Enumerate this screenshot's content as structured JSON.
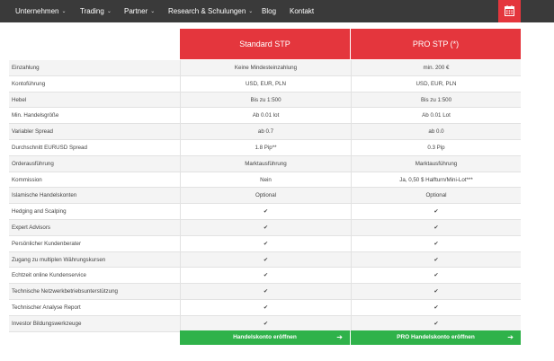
{
  "nav": {
    "items": [
      {
        "label": "Unternehmen",
        "dropdown": true
      },
      {
        "label": "Trading",
        "dropdown": true
      },
      {
        "label": "Partner",
        "dropdown": true
      },
      {
        "label": "Research & Schulungen",
        "dropdown": true
      },
      {
        "label": "Blog",
        "dropdown": false
      },
      {
        "label": "Kontakt",
        "dropdown": false
      }
    ],
    "chevron": "⌄",
    "calendar_icon": "calendar-icon"
  },
  "plans": {
    "standard": "Standard STP",
    "pro": "PRO STP (*)"
  },
  "check_mark": "✔",
  "rows": [
    {
      "label": "Einzahlung",
      "standard": "Keine Mindesteinzahlung",
      "pro": "min. 200 €"
    },
    {
      "label": "Kontoführung",
      "standard": "USD, EUR, PLN",
      "pro": "USD, EUR, PLN"
    },
    {
      "label": "Hebel",
      "standard": "Bis zu 1:500",
      "pro": "Bis zu 1:500"
    },
    {
      "label": "Min. Handelsgröße",
      "standard": "Ab 0.01 lot",
      "pro": "Ab 0.01 Lot"
    },
    {
      "label": "Variabler Spread",
      "standard": "ab 0.7",
      "pro": "ab 0.0"
    },
    {
      "label": "Durchschnitt EURUSD Spread",
      "standard": "1.8 Pip**",
      "pro": "0.3 Pip"
    },
    {
      "label": "Orderausführung",
      "standard": "Marktausführung",
      "pro": "Marktausführung"
    },
    {
      "label": "Kommission",
      "standard": "Nein",
      "pro": "Ja, 0,50 $ Halfturn/Mini-Lot***"
    },
    {
      "label": "Islamische Handelskonten",
      "standard": "Optional",
      "pro": "Optional"
    },
    {
      "label": "Hedging and Scalping",
      "standard": "✔",
      "pro": "✔"
    },
    {
      "label": "Expert Advisors",
      "standard": "✔",
      "pro": "✔"
    },
    {
      "label": "Persönlicher Kundenberater",
      "standard": "✔",
      "pro": "✔"
    },
    {
      "label": "Zugang zu multiplen Währungskursen",
      "standard": "✔",
      "pro": "✔"
    },
    {
      "label": "Echtzeit online Kundenservice",
      "standard": "✔",
      "pro": "✔"
    },
    {
      "label": "Technische Netzwerkbetriebsunterstützung",
      "standard": "✔",
      "pro": "✔"
    },
    {
      "label": "Technischer Analyse Report",
      "standard": "✔",
      "pro": "✔"
    },
    {
      "label": "Investor Bildungswerkzeuge",
      "standard": "✔",
      "pro": "✔"
    }
  ],
  "cta": {
    "standard": "Handelskonto eröffnen",
    "pro": "PRO Handelskonto eröffnen",
    "arrow": "➔"
  },
  "colors": {
    "nav_bg": "#3a3a3a",
    "accent_red": "#e4363d",
    "check_green": "#2fb24a",
    "cta_green": "#2fb24a"
  }
}
